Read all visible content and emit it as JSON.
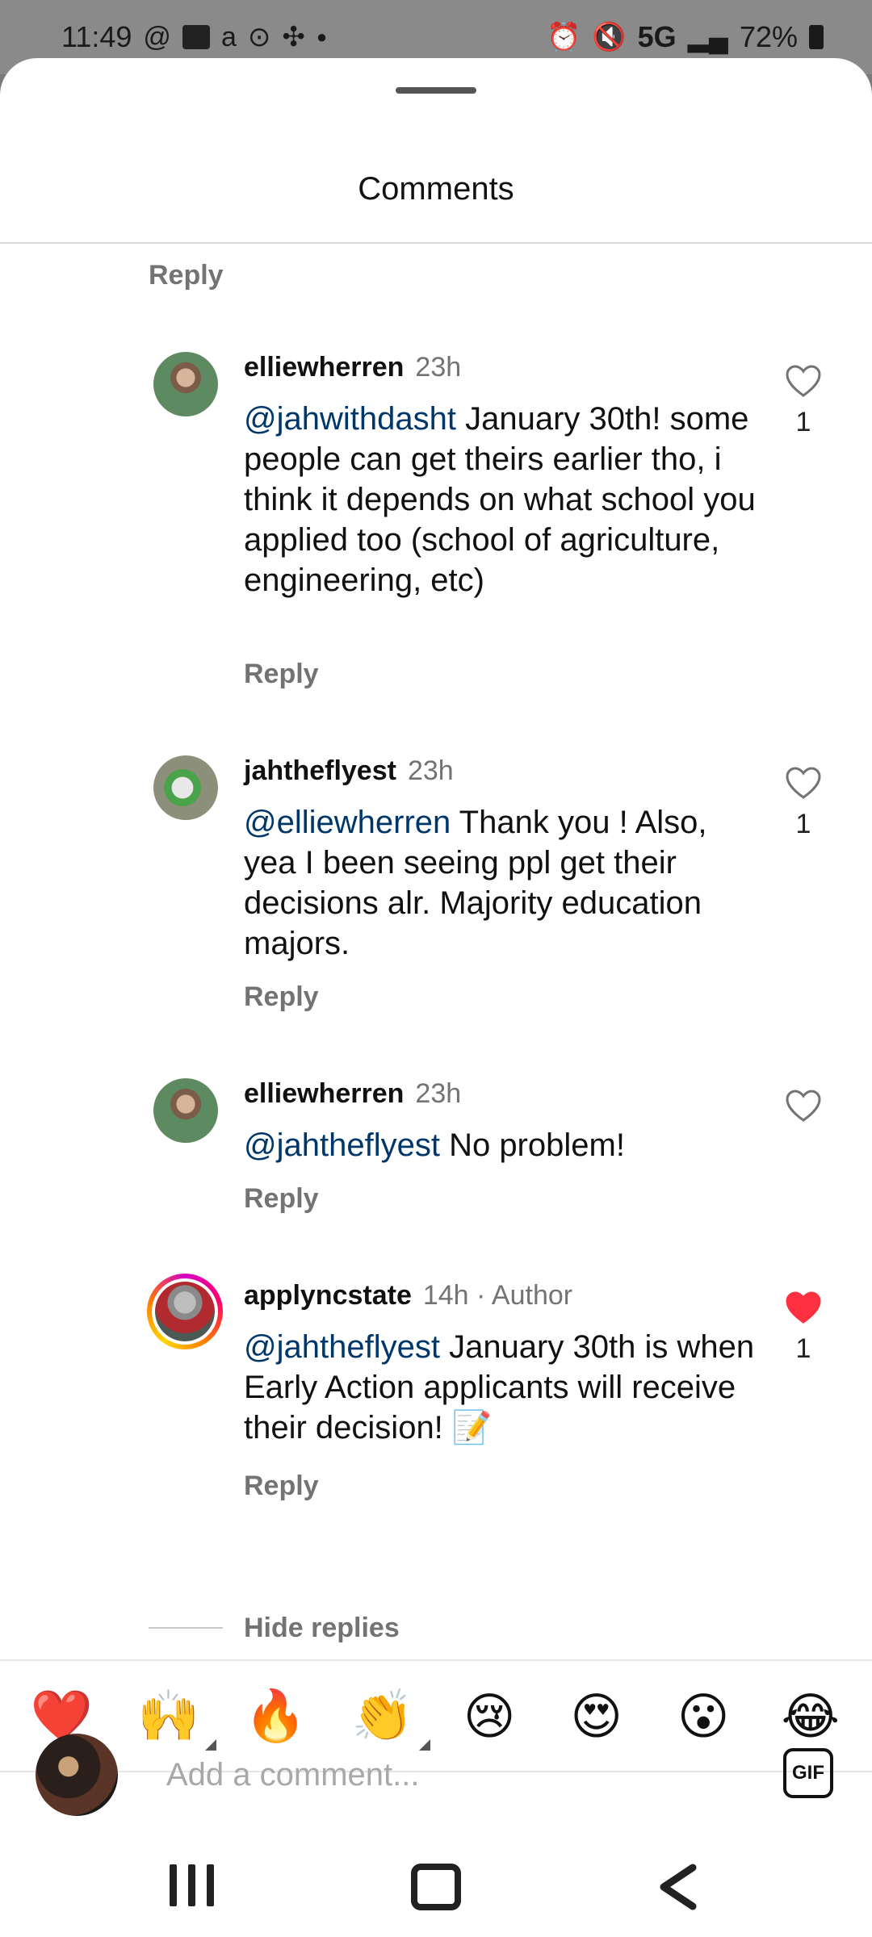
{
  "status_bar": {
    "time": "11:49",
    "network": "5G",
    "battery": "72%",
    "left_icons": [
      "threads-icon",
      "calendar-icon",
      "amazon-icon",
      "record-icon",
      "pinwheel-icon",
      "dot-icon"
    ],
    "right_icons": [
      "alarm-icon",
      "mute-icon",
      "signal-icon",
      "battery-icon"
    ]
  },
  "sheet": {
    "title": "Comments"
  },
  "top_reply_label": "Reply",
  "comments": [
    {
      "username": "elliewherren",
      "time": "23h",
      "author_tag": "",
      "mention": "@jahwithdasht",
      "text": " January 30th! some people can get theirs earlier tho, i think it depends on what school you applied too (school of agriculture, engineering, etc)",
      "reply_label": "Reply",
      "like_count": "1",
      "liked": false
    },
    {
      "username": "jahtheflyest",
      "time": "23h",
      "author_tag": "",
      "mention": "@elliewherren",
      "text": " Thank you ! Also, yea I been seeing ppl get their decisions alr. Majority education majors.",
      "reply_label": "Reply",
      "like_count": "1",
      "liked": false
    },
    {
      "username": "elliewherren",
      "time": "23h",
      "author_tag": "",
      "mention": "@jahtheflyest",
      "text": " No problem!",
      "reply_label": "Reply",
      "like_count": "",
      "liked": false
    },
    {
      "username": "applyncstate",
      "time": "14h",
      "author_tag": " · Author",
      "mention": "@jahtheflyest",
      "text": " January 30th is when Early Action applicants will receive their decision! 📝",
      "reply_label": "Reply",
      "like_count": "1",
      "liked": true
    }
  ],
  "hide_replies_label": "Hide replies",
  "emoji_bar": [
    "❤️",
    "🙌",
    "🔥",
    "👏",
    "😢",
    "😍",
    "😮",
    "😂"
  ],
  "composer": {
    "placeholder": "Add a comment...",
    "gif_label": "GIF"
  },
  "colors": {
    "mention": "#00376b",
    "liked_heart": "#ff3040",
    "secondary_text": "#737373"
  }
}
